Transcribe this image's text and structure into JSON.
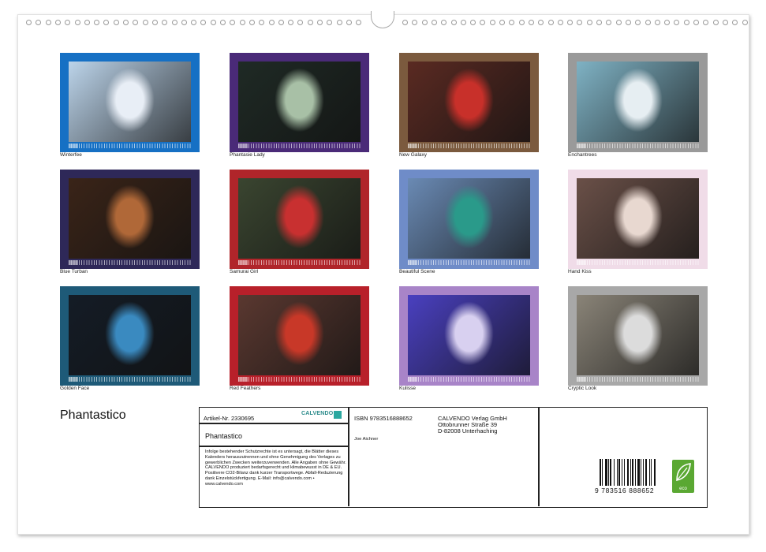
{
  "title": "Phantastico",
  "tiles": [
    {
      "caption": "Winterfee",
      "frame": "#1670c4",
      "bg": "#bcd4ea",
      "fg": "#e8eef6"
    },
    {
      "caption": "Phantasie Lady",
      "frame": "#4a2a78",
      "bg": "#1f2a25",
      "fg": "#a8c0a6"
    },
    {
      "caption": "New Galaxy",
      "frame": "#7b5a3e",
      "bg": "#5a2a22",
      "fg": "#c8302a"
    },
    {
      "caption": "Enchantrees",
      "frame": "#9a9a9a",
      "bg": "#7fb2c4",
      "fg": "#e6eef2"
    },
    {
      "caption": "Blue Turban",
      "frame": "#2e2858",
      "bg": "#3a2418",
      "fg": "#b06838"
    },
    {
      "caption": "Samurai Girl",
      "frame": "#b0252a",
      "bg": "#3a4530",
      "fg": "#c83030"
    },
    {
      "caption": "Beautiful Scene",
      "frame": "#6f8cc8",
      "bg": "#6a8ab4",
      "fg": "#2a9a8a"
    },
    {
      "caption": "Hand Kiss",
      "frame": "#f0dce8",
      "bg": "#6a5048",
      "fg": "#e8d8d0"
    },
    {
      "caption": "Golden Face",
      "frame": "#1e5a78",
      "bg": "#141c26",
      "fg": "#3a8ac0"
    },
    {
      "caption": "Red Feathers",
      "frame": "#b8202a",
      "bg": "#5a3830",
      "fg": "#c83828"
    },
    {
      "caption": "Kulisse",
      "frame": "#a884c8",
      "bg": "#4a40c0",
      "fg": "#d8d0f0"
    },
    {
      "caption": "Cryptic Look",
      "frame": "#a8a8a8",
      "bg": "#8a8478",
      "fg": "#dcdcdc"
    }
  ],
  "info": {
    "article_no": "Artikel-Nr. 2330695",
    "calvendo_logo": "CALVENDO",
    "product_title": "Phantastico",
    "isbn": "ISBN 9783516888652",
    "author": "Joe Aichner",
    "publisher_name": "CALVENDO Verlag GmbH",
    "publisher_street": "Ottobrunner Straße 39",
    "publisher_city": "D-82008 Unterhaching",
    "legal_text": "Infolge bestehender Schutzrechte ist es untersagt, die Blätter dieses Kalenders herauszutrennen und ohne Genehmigung des Verlages zu gewerblichen Zwecken weiterzuverwenden. Alle Angaben ohne Gewähr. CALVENDO produziert bedarfsgerecht und klimabewusst in DE & EU. Positivere CO2-Bilanz dank kurzer Transportwege. Abfall-Reduzierung dank Einzelstückfertigung. E-Mail: info@calvendo.com • www.calvendo.com",
    "barcode_digits": "9 783516 888652",
    "eco_label": "eco"
  }
}
